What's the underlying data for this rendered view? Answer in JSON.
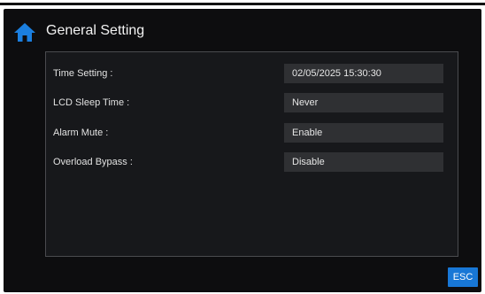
{
  "header": {
    "title": "General Setting",
    "icon": "home-icon",
    "icon_color": "#1b7fe0"
  },
  "settings": [
    {
      "label": "Time Setting :",
      "value": "02/05/2025  15:30:30"
    },
    {
      "label": "LCD Sleep Time :",
      "value": "Never"
    },
    {
      "label": "Alarm Mute :",
      "value": "Enable"
    },
    {
      "label": "Overload Bypass :",
      "value": "Disable"
    }
  ],
  "footer": {
    "esc_label": "ESC",
    "esc_color": "#1877d6"
  }
}
